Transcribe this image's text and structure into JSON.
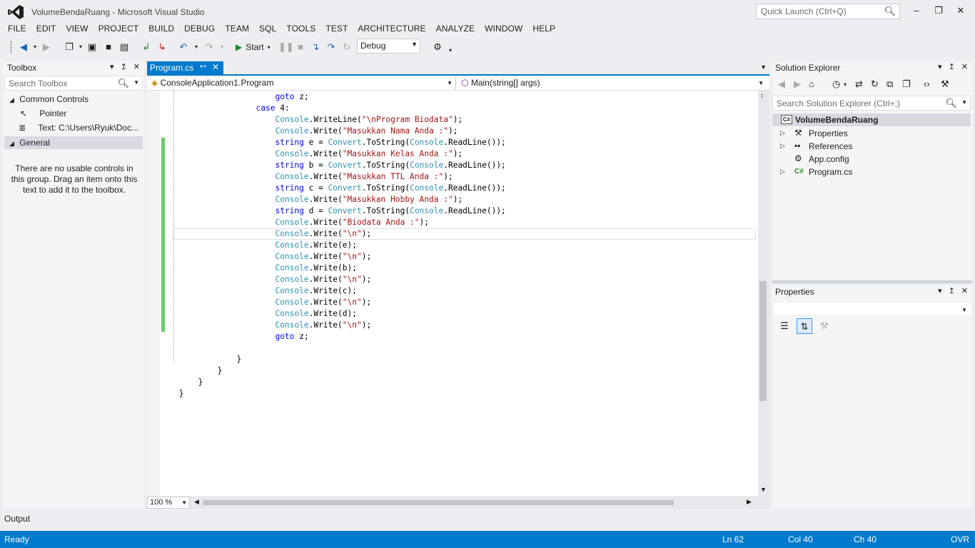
{
  "window": {
    "title": "VolumeBendaRuang - Microsoft Visual Studio",
    "quick_launch_placeholder": "Quick Launch (Ctrl+Q)",
    "accent": "#007acc"
  },
  "menu": [
    "FILE",
    "EDIT",
    "VIEW",
    "PROJECT",
    "BUILD",
    "DEBUG",
    "TEAM",
    "SQL",
    "TOOLS",
    "TEST",
    "ARCHITECTURE",
    "ANALYZE",
    "WINDOW",
    "HELP"
  ],
  "toolbar": {
    "start_label": "Start",
    "config_value": "Debug"
  },
  "toolbox": {
    "title": "Toolbox",
    "search_placeholder": "Search Toolbox",
    "group_common": "Common Controls",
    "item_pointer": "Pointer",
    "item_text": "Text: C:\\Users\\Ryuk\\Doc...",
    "group_general": "General",
    "empty_message": "There are no usable controls in this group. Drag an item onto this text to add it to the toolbox."
  },
  "editor": {
    "tab_label": "Program.cs",
    "nav_class": "ConsoleApplication1.Program",
    "nav_member": "Main(string[] args)",
    "zoom": "100 %"
  },
  "solution_explorer": {
    "title": "Solution Explorer",
    "search_placeholder": "Search Solution Explorer (Ctrl+;)",
    "project": "VolumeBendaRuang",
    "items": [
      "Properties",
      "References",
      "App.config",
      "Program.cs"
    ]
  },
  "properties": {
    "title": "Properties"
  },
  "output": {
    "title": "Output"
  },
  "status": {
    "state": "Ready",
    "line": "Ln 62",
    "col": "Col 40",
    "ch": "Ch 40",
    "mode": "OVR"
  }
}
